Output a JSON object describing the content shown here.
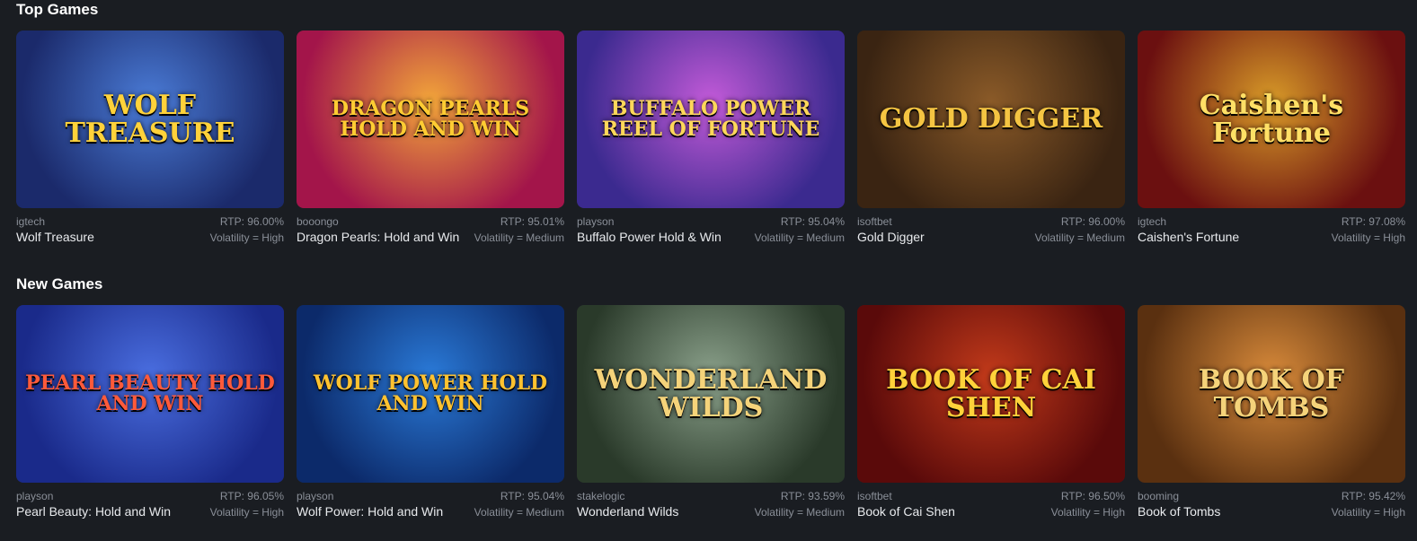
{
  "top_games": {
    "title": "Top Games",
    "games": [
      {
        "provider": "igtech",
        "rtp": "RTP: 96.00%",
        "name": "Wolf Treasure",
        "volatility": "Volatility = High",
        "logo": "WOLF TREASURE",
        "colors": [
          "#1b2a6b",
          "#4a7bd6"
        ],
        "logo_color": "#ffd23a"
      },
      {
        "provider": "booongo",
        "rtp": "RTP: 95.01%",
        "name": "Dragon Pearls: Hold and Win",
        "volatility": "Volatility = Medium",
        "logo": "DRAGON PEARLS HOLD AND WIN",
        "colors": [
          "#a3154a",
          "#f2a53a"
        ],
        "logo_color": "#ffcc33"
      },
      {
        "provider": "playson",
        "rtp": "RTP: 95.04%",
        "name": "Buffalo Power Hold & Win",
        "volatility": "Volatility = Medium",
        "logo": "BUFFALO POWER REEL OF FORTUNE",
        "colors": [
          "#3b2a8f",
          "#c25ad8"
        ],
        "logo_color": "#ffd75a"
      },
      {
        "provider": "isoftbet",
        "rtp": "RTP: 96.00%",
        "name": "Gold Digger",
        "volatility": "Volatility = Medium",
        "logo": "GOLD DIGGER",
        "colors": [
          "#3a2412",
          "#8a5a28"
        ],
        "logo_color": "#f5c542"
      },
      {
        "provider": "igtech",
        "rtp": "RTP: 97.08%",
        "name": "Caishen's Fortune",
        "volatility": "Volatility = High",
        "logo": "Caishen's Fortune",
        "colors": [
          "#6b1010",
          "#d89a28"
        ],
        "logo_color": "#ffe066"
      }
    ]
  },
  "new_games": {
    "title": "New Games",
    "games": [
      {
        "provider": "playson",
        "rtp": "RTP: 96.05%",
        "name": "Pearl Beauty: Hold and Win",
        "volatility": "Volatility = High",
        "logo": "PEARL BEAUTY HOLD AND WIN",
        "colors": [
          "#1a2a8a",
          "#4a6ee0"
        ],
        "logo_color": "#ff5a3a"
      },
      {
        "provider": "playson",
        "rtp": "RTP: 95.04%",
        "name": "Wolf Power: Hold and Win",
        "volatility": "Volatility = Medium",
        "logo": "WOLF POWER HOLD AND WIN",
        "colors": [
          "#0c2a6a",
          "#2a7ad8"
        ],
        "logo_color": "#ffc230"
      },
      {
        "provider": "stakelogic",
        "rtp": "RTP: 93.59%",
        "name": "Wonderland Wilds",
        "volatility": "Volatility = Medium",
        "logo": "WONDERLAND WILDS",
        "colors": [
          "#2a3a2a",
          "#8aa08a"
        ],
        "logo_color": "#f5d37a"
      },
      {
        "provider": "isoftbet",
        "rtp": "RTP: 96.50%",
        "name": "Book of Cai Shen",
        "volatility": "Volatility = High",
        "logo": "BOOK OF CAI SHEN",
        "colors": [
          "#5a0a0a",
          "#c23a1a"
        ],
        "logo_color": "#ffd23a"
      },
      {
        "provider": "booming",
        "rtp": "RTP: 95.42%",
        "name": "Book of Tombs",
        "volatility": "Volatility = High",
        "logo": "BOOK OF TOMBS",
        "colors": [
          "#5a3010",
          "#d88a3a"
        ],
        "logo_color": "#f5d37a"
      }
    ]
  }
}
